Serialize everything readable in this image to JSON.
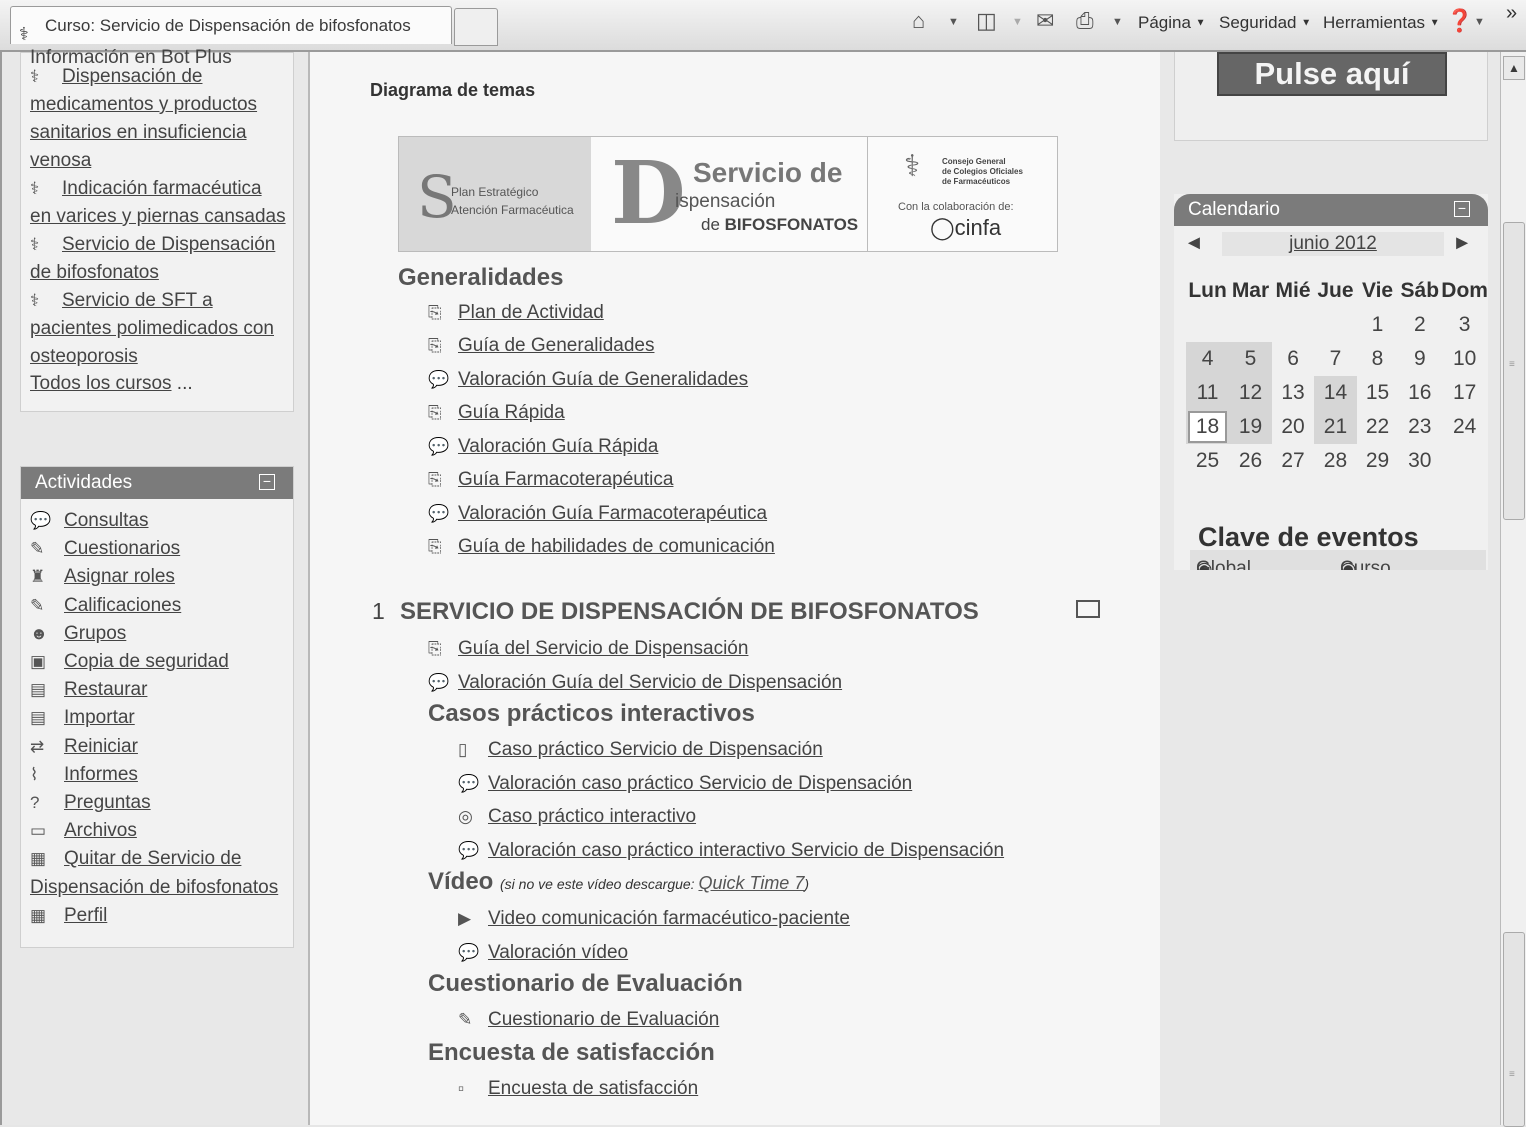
{
  "browser": {
    "tab_title": "Curso: Servicio de Dispensación de bifosfonatos",
    "menus": [
      {
        "label": "Página"
      },
      {
        "label": "Seguridad"
      },
      {
        "label": "Herramientas"
      }
    ],
    "chevron": "»"
  },
  "left": {
    "course_cut_text": "Información en Bot Plus",
    "courses": [
      {
        "label": "Dispensación de medicamentos y productos sanitarios en insuficiencia venosa"
      },
      {
        "label": "Indicación farmacéutica en varices y piernas cansadas"
      },
      {
        "label": "Servicio de Dispensación de bifosfonatos"
      },
      {
        "label": "Servicio de SFT a pacientes polimedicados con osteoporosis"
      }
    ],
    "all_courses": "Todos los cursos",
    "all_courses_ellipsis": "...",
    "activities_title": "Actividades",
    "activities": [
      {
        "label": "Consultas",
        "icon": "chat-icon"
      },
      {
        "label": "Cuestionarios",
        "icon": "quiz-icon"
      },
      {
        "label": "Asignar roles",
        "icon": "roles-icon"
      },
      {
        "label": "Calificaciones",
        "icon": "grades-icon"
      },
      {
        "label": "Grupos",
        "icon": "groups-icon"
      },
      {
        "label": "Copia de seguridad",
        "icon": "backup-icon"
      },
      {
        "label": "Restaurar",
        "icon": "restore-icon"
      },
      {
        "label": "Importar",
        "icon": "import-icon"
      },
      {
        "label": "Reiniciar",
        "icon": "reset-icon"
      },
      {
        "label": "Informes",
        "icon": "reports-icon"
      },
      {
        "label": "Preguntas",
        "icon": "questions-icon"
      },
      {
        "label": "Archivos",
        "icon": "files-icon"
      },
      {
        "label": "Quitar de Servicio de Dispensación de bifosfonatos",
        "icon": "unenrol-icon"
      },
      {
        "label": "Perfil",
        "icon": "profile-icon"
      }
    ]
  },
  "center": {
    "diagram_title": "Diagrama de temas",
    "banner": {
      "plan_line1": "Plan Estratégico",
      "plan_line2": "Atención Farmacéutica",
      "serv_line1": "Servicio de",
      "serv_line2": "ispensación",
      "serv_line3_prefix": "de",
      "serv_line3_bold": "BIFOSFONATOS",
      "council_line1": "Consejo General",
      "council_line2": "de Colegios Oficiales",
      "council_line3": "de Farmacéuticos",
      "colab": "Con la colaboración de:",
      "cinfa": "cinfa"
    },
    "generalidades_title": "Generalidades",
    "generalidades": [
      {
        "label": "Plan de Actividad",
        "icon": "pdf-icon"
      },
      {
        "label": "Guía de Generalidades",
        "icon": "pdf-icon"
      },
      {
        "label": "Valoración Guía de Generalidades",
        "icon": "chat-icon"
      },
      {
        "label": "Guía Rápida",
        "icon": "pdf-icon"
      },
      {
        "label": "Valoración Guía Rápida",
        "icon": "chat-icon"
      },
      {
        "label": "Guía Farmacoterapéutica",
        "icon": "pdf-icon"
      },
      {
        "label": "Valoración Guía Farmacoterapéutica",
        "icon": "chat-icon"
      },
      {
        "label": "Guía de habilidades de comunicación",
        "icon": "pdf-icon"
      }
    ],
    "section1": {
      "number": "1",
      "title": "SERVICIO DE DISPENSACIÓN DE BIFOSFONATOS",
      "items": [
        {
          "label": "Guía del Servicio de Dispensación",
          "icon": "pdf-icon"
        },
        {
          "label": "Valoración Guía del Servicio de Dispensación",
          "icon": "chat-icon"
        }
      ],
      "casos_title": "Casos prácticos interactivos",
      "casos": [
        {
          "label": "Caso práctico Servicio de Dispensación",
          "icon": "page-icon"
        },
        {
          "label": "Valoración caso práctico Servicio de Dispensación",
          "icon": "chat-icon"
        },
        {
          "label": "Caso práctico interactivo",
          "icon": "interactive-icon"
        },
        {
          "label": "Valoración caso práctico interactivo Servicio de Dispensación",
          "icon": "chat-icon"
        }
      ],
      "video_title": "Vídeo",
      "video_note_pre": "(si no ve este vídeo descargue:",
      "video_note_link": "Quick Time 7",
      "video_note_post": ")",
      "videos": [
        {
          "label": "Video comunicación farmacéutico-paciente",
          "icon": "video-icon"
        },
        {
          "label": "Valoración vídeo",
          "icon": "chat-icon"
        }
      ],
      "cuest_title": "Cuestionario de Evaluación",
      "cuest": [
        {
          "label": "Cuestionario de Evaluación",
          "icon": "quiz-icon"
        }
      ],
      "encuesta_title": "Encuesta de satisfacción",
      "encuesta": [
        {
          "label": "Encuesta de satisfacción",
          "icon": "survey-icon"
        }
      ]
    }
  },
  "right": {
    "pulse_button": "Pulse aquí",
    "calendar_title": "Calendario",
    "month": "junio 2012",
    "weekdays": [
      "Lun",
      "Mar",
      "Mié",
      "Jue",
      "Vie",
      "Sáb",
      "Dom"
    ],
    "weeks": [
      [
        "",
        "",
        "",
        "",
        "1",
        "2",
        "3"
      ],
      [
        "4",
        "5",
        "6",
        "7",
        "8",
        "9",
        "10"
      ],
      [
        "11",
        "12",
        "13",
        "14",
        "15",
        "16",
        "17"
      ],
      [
        "18",
        "19",
        "20",
        "21",
        "22",
        "23",
        "24"
      ],
      [
        "25",
        "26",
        "27",
        "28",
        "29",
        "30",
        ""
      ]
    ],
    "event_days": [
      "4",
      "5",
      "11",
      "12",
      "14",
      "18",
      "19",
      "21"
    ],
    "today": "18",
    "events_title": "Clave de eventos",
    "events": [
      {
        "label": "Global"
      },
      {
        "label": "Curso"
      }
    ]
  }
}
